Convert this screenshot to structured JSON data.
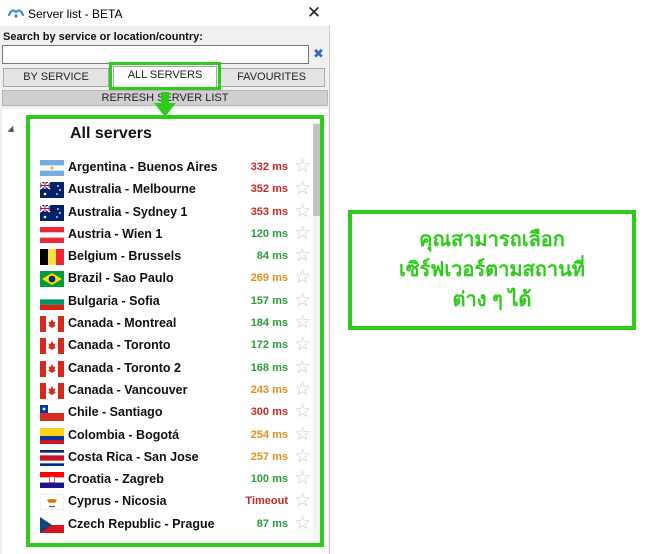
{
  "window": {
    "title": "Server list - BETA",
    "close_symbol": "✕",
    "icon": "app-logo-icon"
  },
  "search": {
    "label": "Search by service or location/country:",
    "value": "",
    "placeholder": "",
    "clear_symbol": "✖"
  },
  "tabs": [
    {
      "label": "BY SERVICE",
      "active": false
    },
    {
      "label": "ALL SERVERS",
      "active": true
    },
    {
      "label": "FAVOURITES",
      "active": false
    }
  ],
  "refresh_label": "REFRESH SERVER LIST",
  "list": {
    "heading": "All servers",
    "servers": [
      {
        "name": "Argentina - Buenos Aires",
        "ping": "332 ms",
        "flag": "argentina-flag-icon"
      },
      {
        "name": "Australia - Melbourne",
        "ping": "352 ms",
        "flag": "australia-flag-icon"
      },
      {
        "name": "Australia - Sydney 1",
        "ping": "353 ms",
        "flag": "australia-flag-icon"
      },
      {
        "name": "Austria - Wien 1",
        "ping": "120 ms",
        "flag": "austria-flag-icon"
      },
      {
        "name": "Belgium - Brussels",
        "ping": "84 ms",
        "flag": "belgium-flag-icon"
      },
      {
        "name": "Brazil - Sao Paulo",
        "ping": "269 ms",
        "flag": "brazil-flag-icon"
      },
      {
        "name": "Bulgaria - Sofia",
        "ping": "157 ms",
        "flag": "bulgaria-flag-icon"
      },
      {
        "name": "Canada - Montreal",
        "ping": "184 ms",
        "flag": "canada-flag-icon"
      },
      {
        "name": "Canada - Toronto",
        "ping": "172 ms",
        "flag": "canada-flag-icon"
      },
      {
        "name": "Canada - Toronto 2",
        "ping": "168 ms",
        "flag": "canada-flag-icon"
      },
      {
        "name": "Canada - Vancouver",
        "ping": "243 ms",
        "flag": "canada-flag-icon"
      },
      {
        "name": "Chile - Santiago",
        "ping": "300 ms",
        "flag": "chile-flag-icon"
      },
      {
        "name": "Colombia - Bogotá",
        "ping": "254 ms",
        "flag": "colombia-flag-icon"
      },
      {
        "name": "Costa Rica - San Jose",
        "ping": "257 ms",
        "flag": "costa-rica-flag-icon"
      },
      {
        "name": "Croatia - Zagreb",
        "ping": "100 ms",
        "flag": "croatia-flag-icon"
      },
      {
        "name": "Cyprus - Nicosia",
        "ping": "Timeout",
        "flag": "cyprus-flag-icon"
      },
      {
        "name": "Czech Republic - Prague",
        "ping": "87 ms",
        "flag": "czech-flag-icon"
      }
    ]
  },
  "colors": {
    "accent_green": "#2ecc1a",
    "ping_fast": "#2a9d3a",
    "ping_medium": "#e0901c",
    "ping_slow": "#c62828"
  },
  "callout_text": "คุณสามารถเลือก\nเซิร์ฟเวอร์ตามสถานที่\nต่าง ๆ ได้"
}
